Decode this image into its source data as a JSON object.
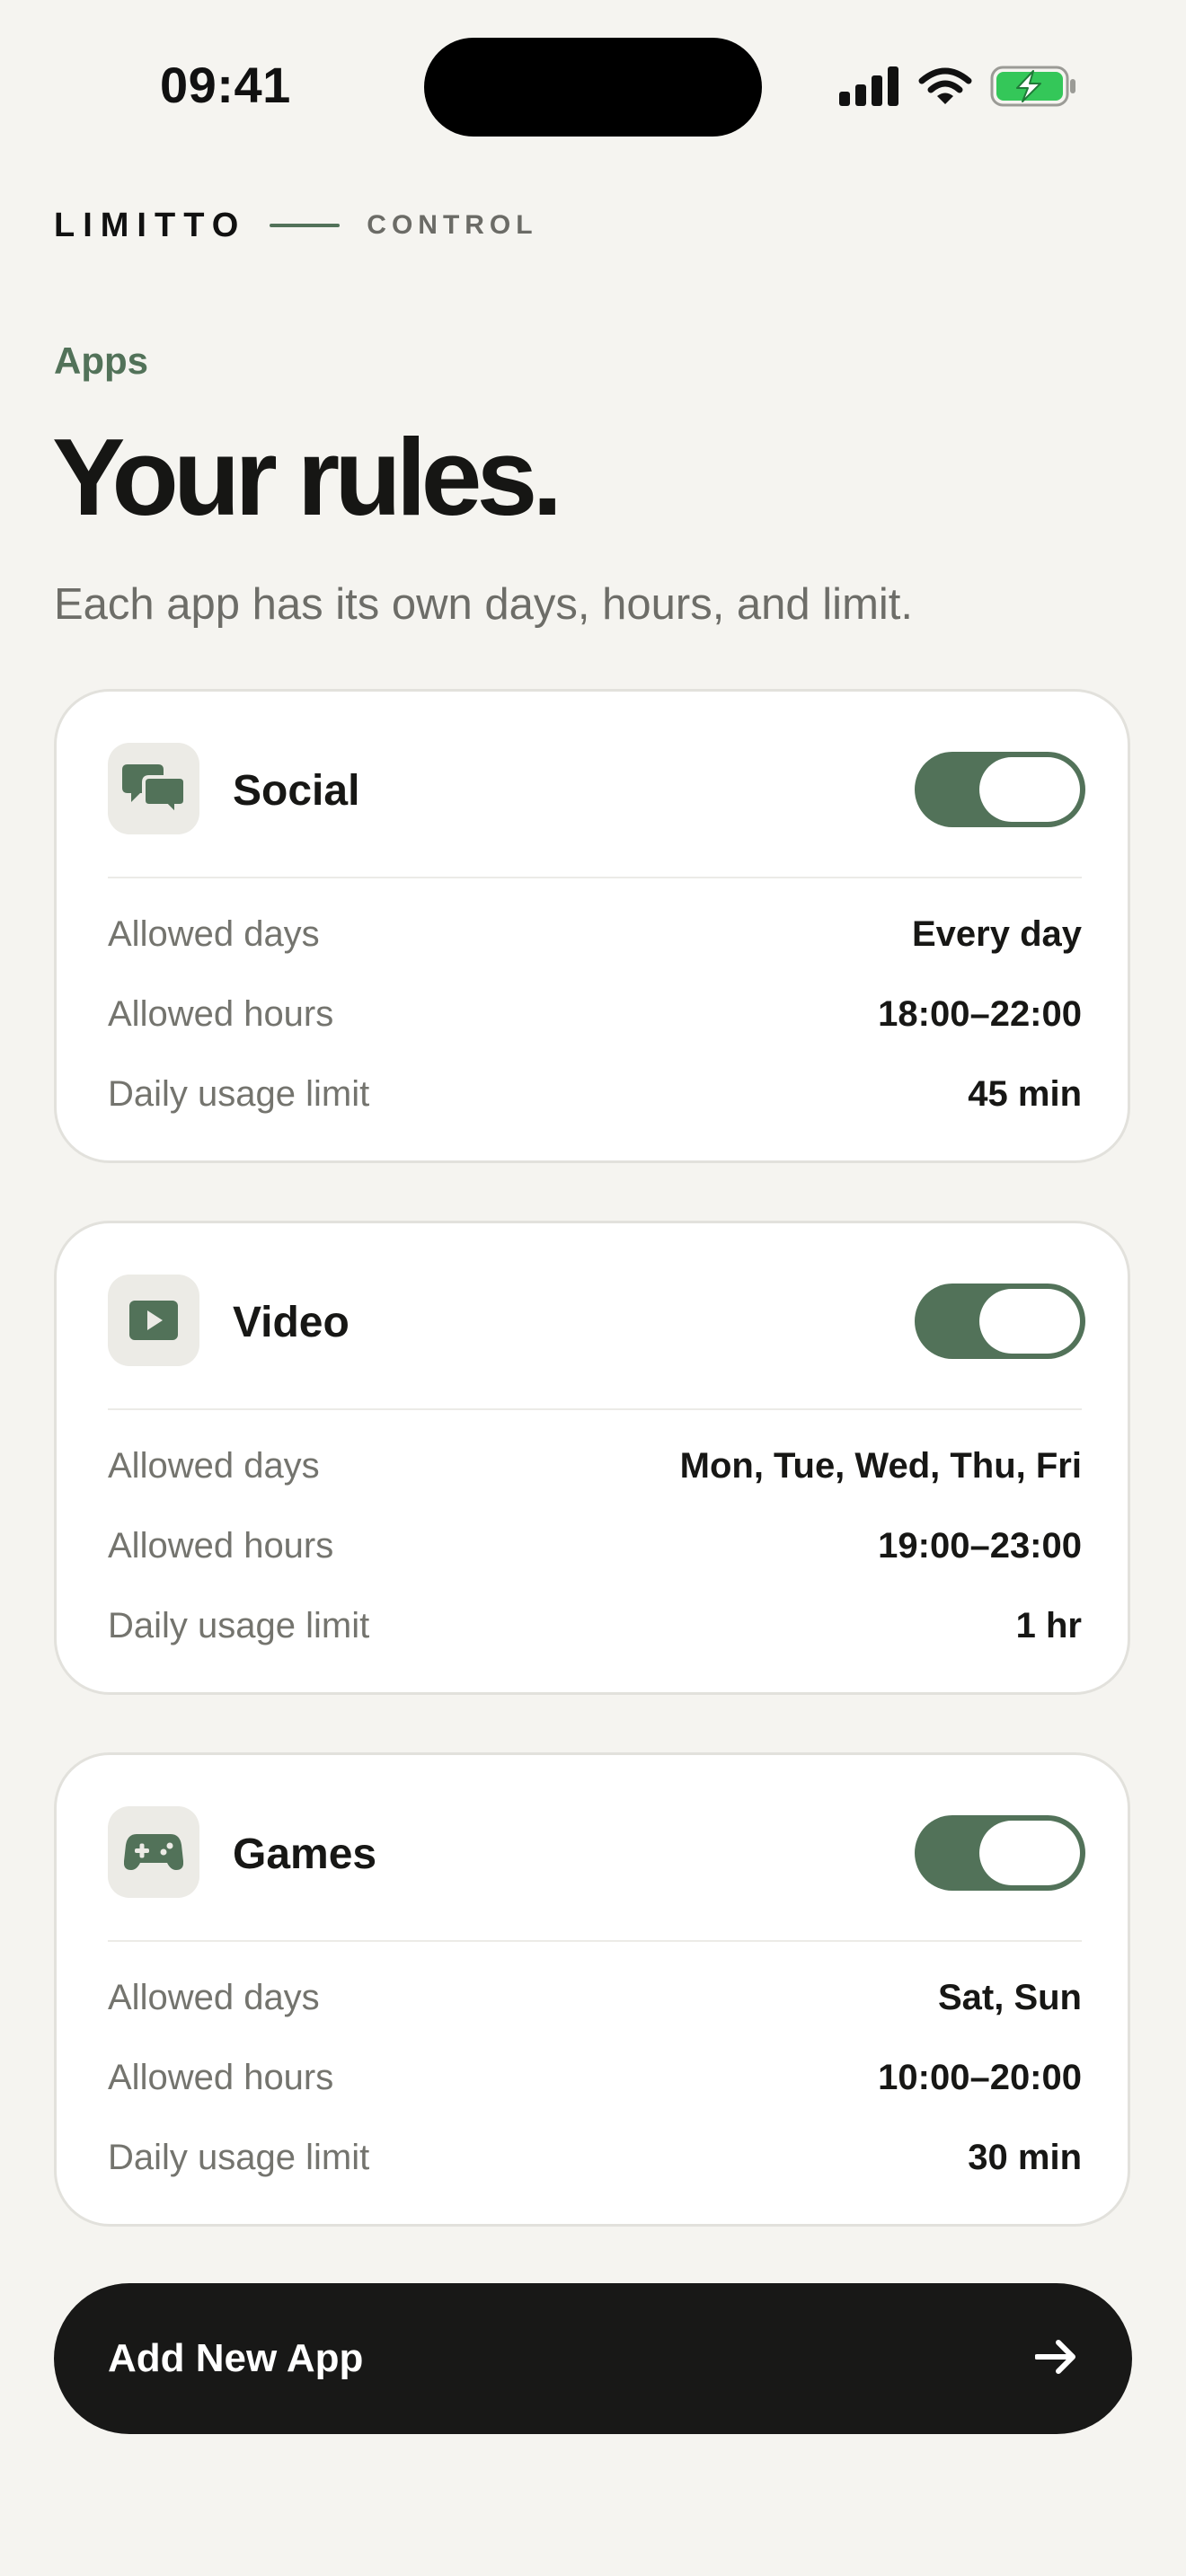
{
  "status_bar": {
    "time": "09:41",
    "icons": [
      "cellular-signal-icon",
      "wifi-icon",
      "battery-charging-icon"
    ],
    "battery_color": "#34c759"
  },
  "brand": {
    "name": "LIMITTO",
    "sub": "CONTROL"
  },
  "page": {
    "eyebrow": "Apps",
    "title": "Your rules.",
    "subtitle": "Each app has its own days, hours, and limit."
  },
  "labels": {
    "days": "Allowed days",
    "hours": "Allowed hours",
    "limit": "Daily usage limit"
  },
  "apps": [
    {
      "name": "Social",
      "icon": "chat-bubbles-icon",
      "enabled": true,
      "days": "Every day",
      "hours": "18:00–22:00",
      "limit": "45 min"
    },
    {
      "name": "Video",
      "icon": "play-icon",
      "enabled": true,
      "days": "Mon, Tue, Wed, Thu, Fri",
      "hours": "19:00–23:00",
      "limit": "1 hr"
    },
    {
      "name": "Games",
      "icon": "gamepad-icon",
      "enabled": true,
      "days": "Sat, Sun",
      "hours": "10:00–20:00",
      "limit": "30 min"
    }
  ],
  "cta": {
    "label": "Add New App",
    "icon": "arrow-right-icon"
  },
  "colors": {
    "accent": "#527259",
    "background": "#f5f4f0",
    "card": "#ffffff",
    "cta_background": "#181817"
  }
}
